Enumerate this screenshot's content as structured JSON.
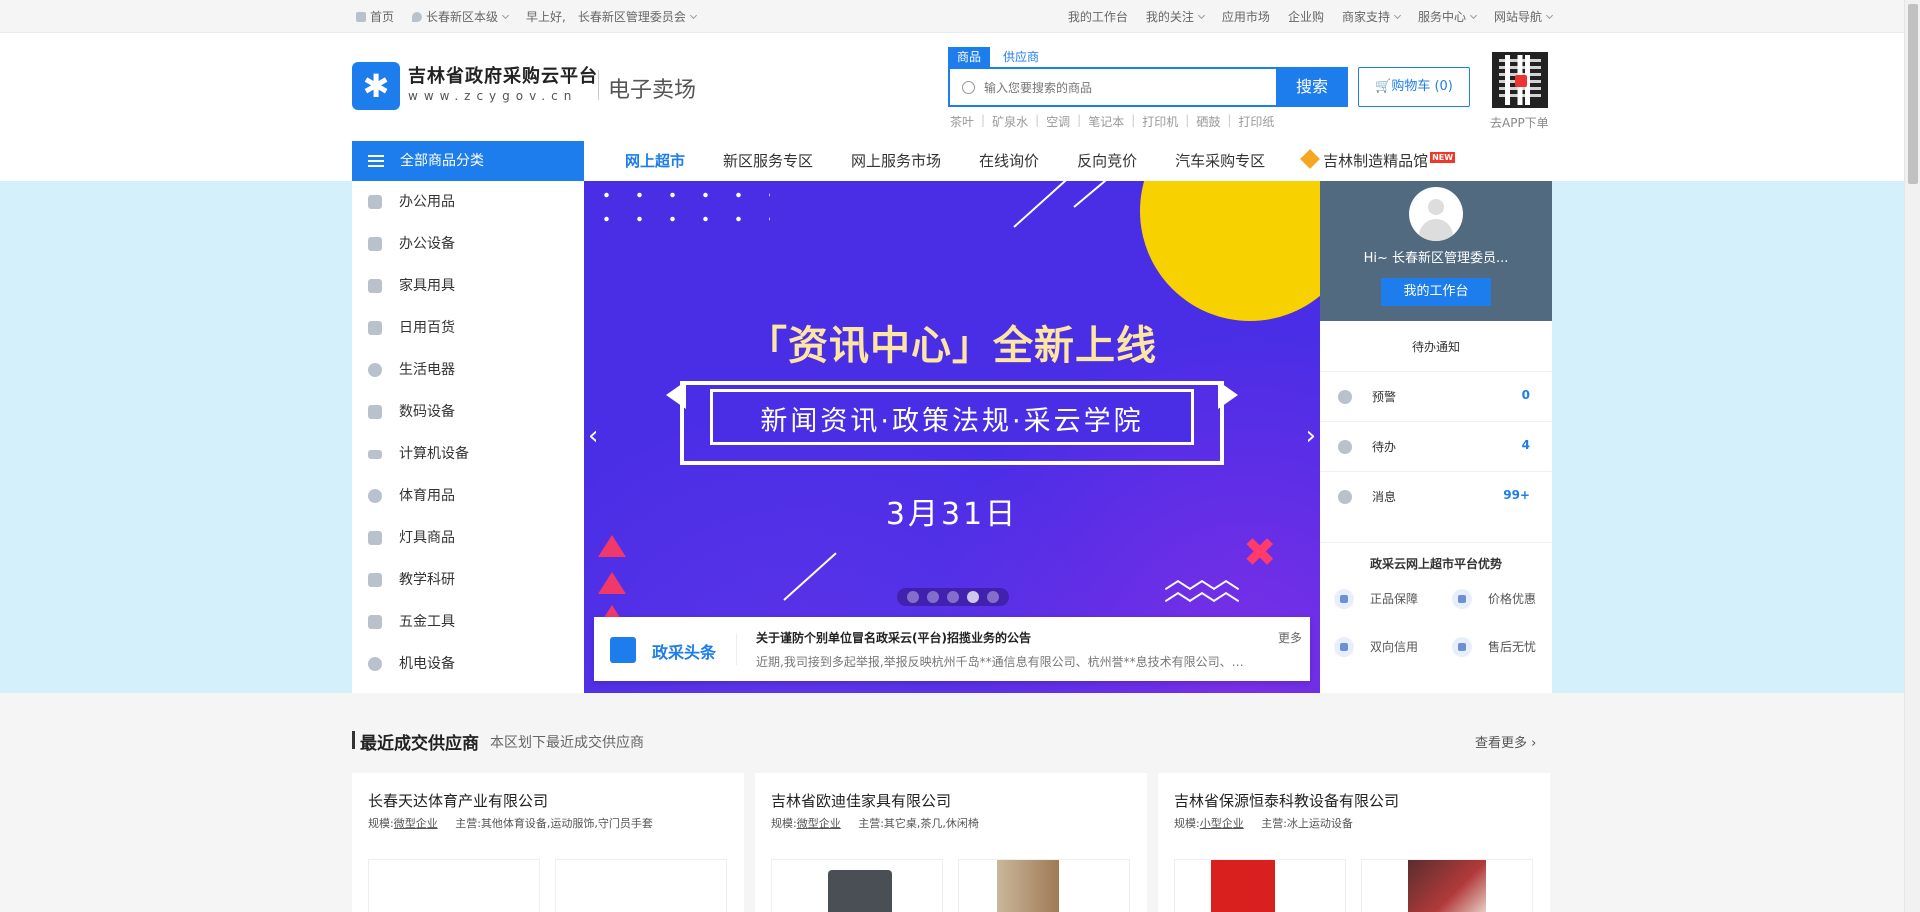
{
  "topbar": {
    "home": "首页",
    "location": "长春新区本级",
    "greeting": "早上好,",
    "org": "长春新区管理委员会",
    "links": [
      "我的工作台",
      "我的关注",
      "应用市场",
      "企业购",
      "商家支持",
      "服务中心",
      "网站导航"
    ]
  },
  "header": {
    "logo_title": "吉林省政府采购云平台",
    "logo_url": "www.zcygov.cn",
    "logo_sub": "电子卖场",
    "search_tabs": [
      "商品",
      "供应商"
    ],
    "search_placeholder": "输入您要搜索的商品",
    "search_button": "搜索",
    "cart_label": "购物车 (0)",
    "hotwords": [
      "茶叶",
      "矿泉水",
      "空调",
      "笔记本",
      "打印机",
      "硒鼓",
      "打印纸"
    ],
    "qr_text": "去APP下单"
  },
  "nav": {
    "all_categories": "全部商品分类",
    "items": [
      "网上超市",
      "新区服务专区",
      "网上服务市场",
      "在线询价",
      "反向竞价",
      "汽车采购专区"
    ],
    "special": "吉林制造精品馆",
    "special_badge": "NEW"
  },
  "categories": [
    "办公用品",
    "办公设备",
    "家具用具",
    "日用百货",
    "生活电器",
    "数码设备",
    "计算机设备",
    "体育用品",
    "灯具商品",
    "教学科研",
    "五金工具",
    "机电设备"
  ],
  "banner": {
    "headline": "「资讯中心」全新上线",
    "subline": "新闻资讯·政策法规·采云学院",
    "date": "3月31日",
    "slides": 5,
    "active_slide": 4
  },
  "news": {
    "label": "政采头条",
    "title": "关于谨防个别单位冒名政采云(平台)招揽业务的公告",
    "summary": "近期,我司接到多起举报,举报反映杭州千岛**通信息有限公司、杭州誉**息技术有限公司、…",
    "more": "更多"
  },
  "user": {
    "greeting": "Hi~ 长春新区管理委员...",
    "workbench": "我的工作台",
    "todo_title": "待办通知",
    "todos": [
      {
        "label": "预警",
        "count": "0"
      },
      {
        "label": "待办",
        "count": "4"
      },
      {
        "label": "消息",
        "count": "99+"
      }
    ],
    "adv_title": "政采云网上超市平台优势",
    "advantages": [
      "正品保障",
      "价格优惠",
      "双向信用",
      "售后无忧"
    ]
  },
  "suppliers": {
    "title": "最近成交供应商",
    "subtitle": "本区划下最近成交供应商",
    "more": "查看更多",
    "scale_label": "规模:",
    "main_label": "主营:",
    "cards": [
      {
        "name": "长春天达体育产业有限公司",
        "scale": "微型企业",
        "main": "其他体育设备,运动服饰,守门员手套"
      },
      {
        "name": "吉林省欧迪佳家具有限公司",
        "scale": "微型企业",
        "main": "其它桌,茶几,休闲椅"
      },
      {
        "name": "吉林省保源恒泰科教设备有限公司",
        "scale": "小型企业",
        "main": "冰上运动设备"
      }
    ]
  },
  "colors": {
    "brand_blue": "#1e7dec",
    "band_bg": "#d3f0fb",
    "banner_purple": "#4a2ee6",
    "banner_yellow": "#fde6a2"
  }
}
